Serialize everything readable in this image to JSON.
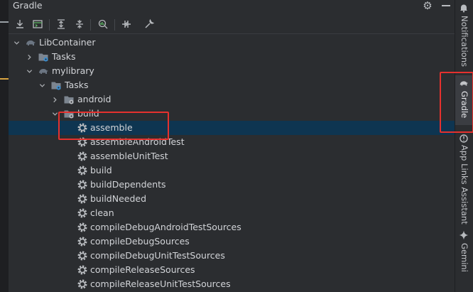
{
  "panel": {
    "title": "Gradle"
  },
  "toolbar": {
    "buttons": [
      {
        "icon": "download-icon"
      },
      {
        "icon": "run-task-icon"
      },
      {
        "icon": "expand-all-icon"
      },
      {
        "icon": "collapse-all-icon"
      },
      {
        "icon": "analyze-dependencies-icon"
      },
      {
        "icon": "toggle-offline-mode-icon"
      },
      {
        "icon": "build-settings-wrench-icon"
      }
    ]
  },
  "tree": {
    "nodes": [
      {
        "label": "LibContainer",
        "kind": "gradle-project",
        "expanded": true
      },
      {
        "label": "Tasks",
        "kind": "task-folder",
        "expanded": false
      },
      {
        "label": "mylibrary",
        "kind": "gradle-project",
        "expanded": true
      },
      {
        "label": "Tasks",
        "kind": "task-folder",
        "expanded": true
      },
      {
        "label": "android",
        "kind": "task-group",
        "expanded": false
      },
      {
        "label": "build",
        "kind": "task-group",
        "expanded": true
      },
      {
        "label": "assemble",
        "kind": "task",
        "selected": true
      },
      {
        "label": "assembleAndroidTest",
        "kind": "task"
      },
      {
        "label": "assembleUnitTest",
        "kind": "task"
      },
      {
        "label": "build",
        "kind": "task"
      },
      {
        "label": "buildDependents",
        "kind": "task"
      },
      {
        "label": "buildNeeded",
        "kind": "task"
      },
      {
        "label": "clean",
        "kind": "task"
      },
      {
        "label": "compileDebugAndroidTestSources",
        "kind": "task"
      },
      {
        "label": "compileDebugSources",
        "kind": "task"
      },
      {
        "label": "compileDebugUnitTestSources",
        "kind": "task"
      },
      {
        "label": "compileReleaseSources",
        "kind": "task"
      },
      {
        "label": "compileReleaseUnitTestSources",
        "kind": "task"
      }
    ]
  },
  "right_stripe": {
    "items": [
      {
        "label": "Notifications",
        "icon": "bell-icon",
        "active": false
      },
      {
        "label": "Gradle",
        "icon": "gradle-elephant-icon",
        "active": true
      },
      {
        "label": "App Links Assistant",
        "icon": "link-icon",
        "active": false
      },
      {
        "label": "Gemini",
        "icon": "gemini-sparkle-icon",
        "active": false
      }
    ]
  },
  "colors": {
    "background": "#2b2d30",
    "selection": "#0e3551",
    "annotation_red": "#e5312e",
    "text": "#d2d4d8"
  }
}
